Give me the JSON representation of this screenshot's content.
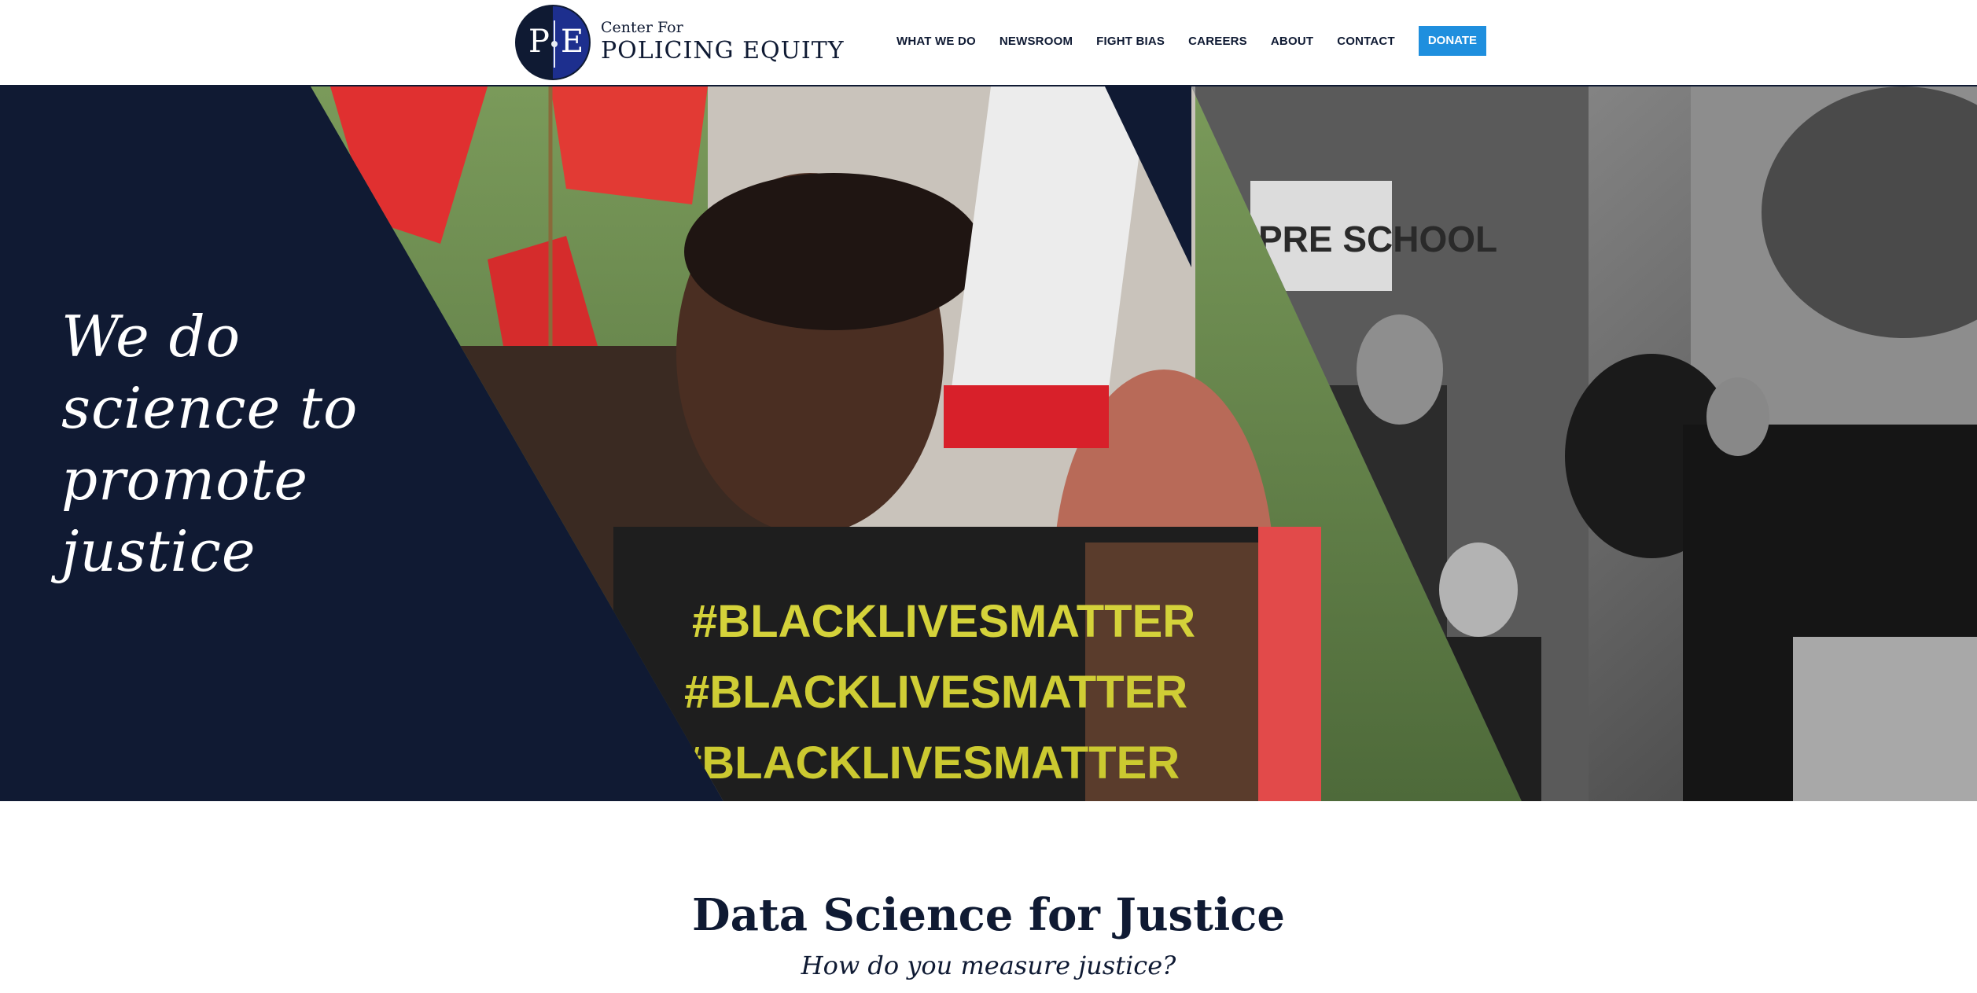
{
  "brand": {
    "logo_letters": [
      "P",
      "E"
    ],
    "name_small": "Center For",
    "name_big": "POLICING EQUITY"
  },
  "nav": {
    "items": [
      "WHAT WE DO",
      "NEWSROOM",
      "FIGHT BIAS",
      "CAREERS",
      "ABOUT",
      "CONTACT"
    ],
    "donate": "DONATE"
  },
  "hero": {
    "title": "We do science to promote justice",
    "protest_shirt_text": "#BLACKLIVESMATTER",
    "storefront_sign": "PRE SCHOOL"
  },
  "intro": {
    "title": "Data Science for Justice",
    "subtitle": "How do you measure justice?"
  },
  "colors": {
    "navy": "#0f1a33",
    "donate_blue": "#1f8fde",
    "logo_blue": "#1d2f8e"
  },
  "icons": {
    "logo": "pe-monogram-logo"
  }
}
